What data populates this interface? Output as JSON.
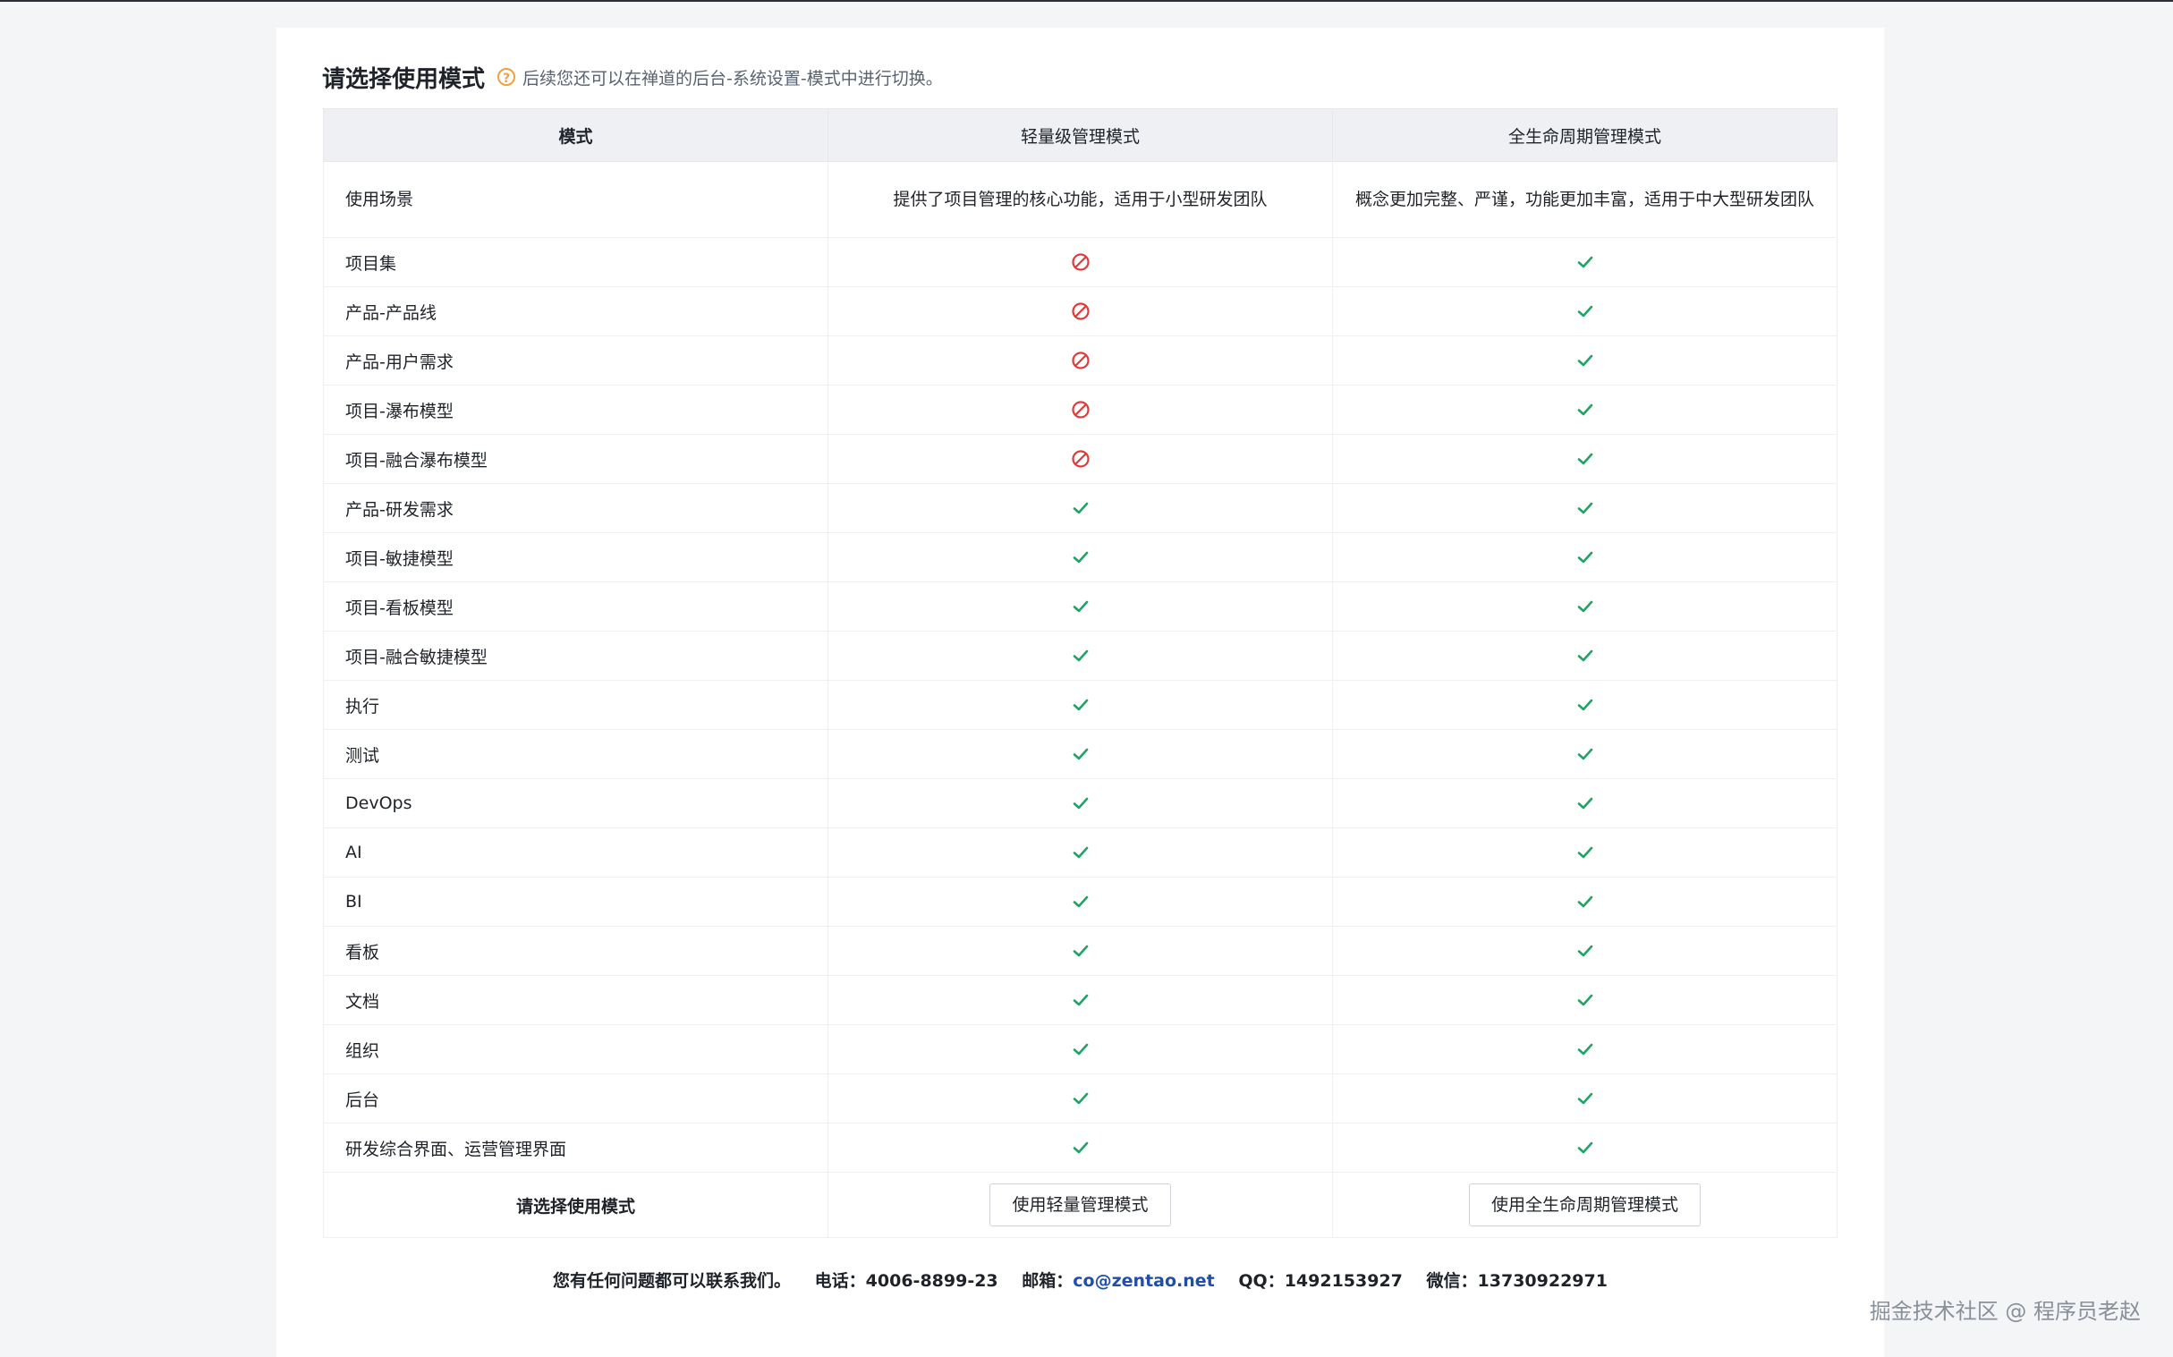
{
  "page": {
    "title": "请选择使用模式",
    "hint": "后续您还可以在禅道的后台-系统设置-模式中进行切换。"
  },
  "table": {
    "headers": [
      "模式",
      "轻量级管理模式",
      "全生命周期管理模式"
    ],
    "scenario": {
      "label": "使用场景",
      "light": "提供了项目管理的核心功能，适用于小型研发团队",
      "full": "概念更加完整、严谨，功能更加丰富，适用于中大型研发团队"
    },
    "rows": [
      {
        "label": "项目集",
        "light": false,
        "full": true
      },
      {
        "label": "产品-产品线",
        "light": false,
        "full": true
      },
      {
        "label": "产品-用户需求",
        "light": false,
        "full": true
      },
      {
        "label": "项目-瀑布模型",
        "light": false,
        "full": true
      },
      {
        "label": "项目-融合瀑布模型",
        "light": false,
        "full": true
      },
      {
        "label": "产品-研发需求",
        "light": true,
        "full": true
      },
      {
        "label": "项目-敏捷模型",
        "light": true,
        "full": true
      },
      {
        "label": "项目-看板模型",
        "light": true,
        "full": true
      },
      {
        "label": "项目-融合敏捷模型",
        "light": true,
        "full": true
      },
      {
        "label": "执行",
        "light": true,
        "full": true
      },
      {
        "label": "测试",
        "light": true,
        "full": true
      },
      {
        "label": "DevOps",
        "light": true,
        "full": true
      },
      {
        "label": "AI",
        "light": true,
        "full": true
      },
      {
        "label": "BI",
        "light": true,
        "full": true
      },
      {
        "label": "看板",
        "light": true,
        "full": true
      },
      {
        "label": "文档",
        "light": true,
        "full": true
      },
      {
        "label": "组织",
        "light": true,
        "full": true
      },
      {
        "label": "后台",
        "light": true,
        "full": true
      },
      {
        "label": "研发综合界面、运营管理界面",
        "light": true,
        "full": true
      }
    ],
    "actions": {
      "label": "请选择使用模式",
      "light_button": "使用轻量管理模式",
      "full_button": "使用全生命周期管理模式"
    }
  },
  "contact": {
    "intro": "您有任何问题都可以联系我们。",
    "phone": "电话：4006-8899-23",
    "email_label": "邮箱：",
    "email": "co@zentao.net",
    "qq": "QQ：1492153927",
    "wechat": "微信：13730922971"
  },
  "credit": "掘金技术社区 @ 程序员老赵",
  "colors": {
    "check": "#21a366",
    "forbid": "#e03a3a",
    "help": "#f0a03c",
    "link": "#1f4fa8"
  },
  "icons": {
    "yes": "check-icon",
    "no": "forbidden-icon",
    "help": "question-circle-icon"
  }
}
